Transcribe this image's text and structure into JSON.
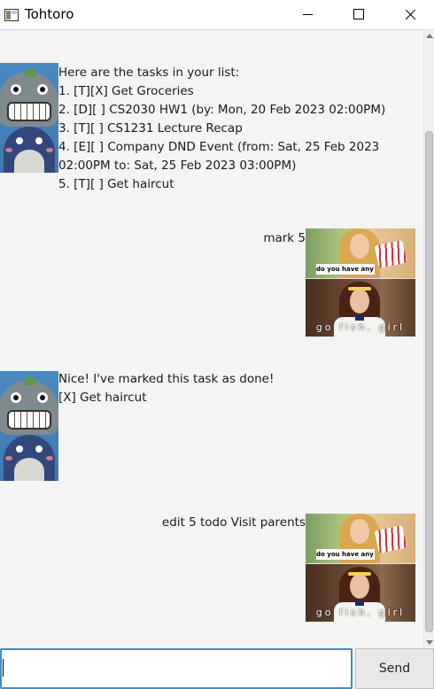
{
  "window": {
    "title": "Tohtoro",
    "icon": "app-window-icon"
  },
  "messages": [
    {
      "sender": "bot",
      "avatar": "totoro-avatar",
      "lines": [
        "Here are the tasks in your list:",
        "1. [T][X] Get Groceries",
        "2. [D][ ] CS2030 HW1 (by: Mon, 20 Feb 2023 02:00PM)",
        "3. [T][ ] CS1231 Lecture Recap",
        "4. [E][ ] Company DND Event (from: Sat, 25 Feb 2023",
        "02:00PM to: Sat, 25 Feb 2023 03:00PM)",
        "5. [T][ ] Get haircut"
      ]
    },
    {
      "sender": "user",
      "avatar": "meme-avatar",
      "text": "mark 5",
      "meme_top_caption": "do you have any fours",
      "meme_bottom_caption": "go fish, girl"
    },
    {
      "sender": "bot",
      "avatar": "totoro-avatar",
      "lines": [
        "Nice! I've marked this task as done!",
        "[X] Get haircut"
      ]
    },
    {
      "sender": "user",
      "avatar": "meme-avatar",
      "text": "edit 5 todo Visit parents",
      "meme_top_caption": "do you have any fours",
      "meme_bottom_caption": "go fish, girl"
    }
  ],
  "input": {
    "value": "",
    "placeholder": ""
  },
  "send_label": "Send",
  "colors": {
    "input_focus": "#3a8fd0",
    "background": "#f4f4f4"
  }
}
